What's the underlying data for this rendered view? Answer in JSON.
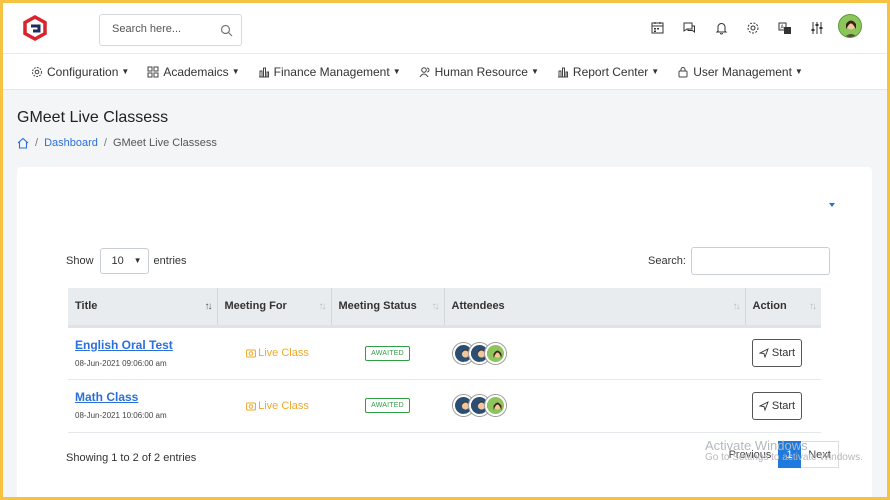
{
  "header": {
    "search_placeholder": "Search here...",
    "icons": [
      "calendar-icon",
      "chat-icon",
      "bell-icon",
      "gear-icon",
      "translate-icon",
      "sliders-icon"
    ]
  },
  "nav": {
    "items": [
      {
        "label": "Configuration",
        "icon": "gear-icon"
      },
      {
        "label": "Academaics",
        "icon": "grid-icon"
      },
      {
        "label": "Finance Management",
        "icon": "bar-chart-icon"
      },
      {
        "label": "Human Resource",
        "icon": "users-icon"
      },
      {
        "label": "Report Center",
        "icon": "bar-chart-icon"
      },
      {
        "label": "User Management",
        "icon": "lock-icon"
      }
    ]
  },
  "page": {
    "title": "GMeet Live Classess",
    "breadcrumb": {
      "dashboard": "Dashboard",
      "current": "GMeet Live Classess"
    }
  },
  "table_controls": {
    "show_label": "Show",
    "entries_value": "10",
    "entries_label": "entries",
    "search_label": "Search:"
  },
  "table": {
    "headers": [
      "Title",
      "Meeting For",
      "Meeting Status",
      "Attendees",
      "Action"
    ],
    "rows": [
      {
        "title": "English Oral Test",
        "date": "08-Jun-2021 09:06:00 am",
        "meeting_for": "Live Class",
        "status": "AWAITED",
        "action": "Start"
      },
      {
        "title": "Math Class",
        "date": "08-Jun-2021 10:06:00 am",
        "meeting_for": "Live Class",
        "status": "AWAITED",
        "action": "Start"
      }
    ]
  },
  "footer": {
    "info": "Showing 1 to 2 of 2 entries",
    "previous": "Previous",
    "page": "1",
    "next": "Next"
  },
  "watermark": {
    "line1": "Activate Windows",
    "line2": "Go to Settings to activate Windows."
  },
  "colors": {
    "accent": "#2a6fdb",
    "warning": "#f0a92a",
    "success": "#2f9e44",
    "frame": "#f5c242"
  }
}
